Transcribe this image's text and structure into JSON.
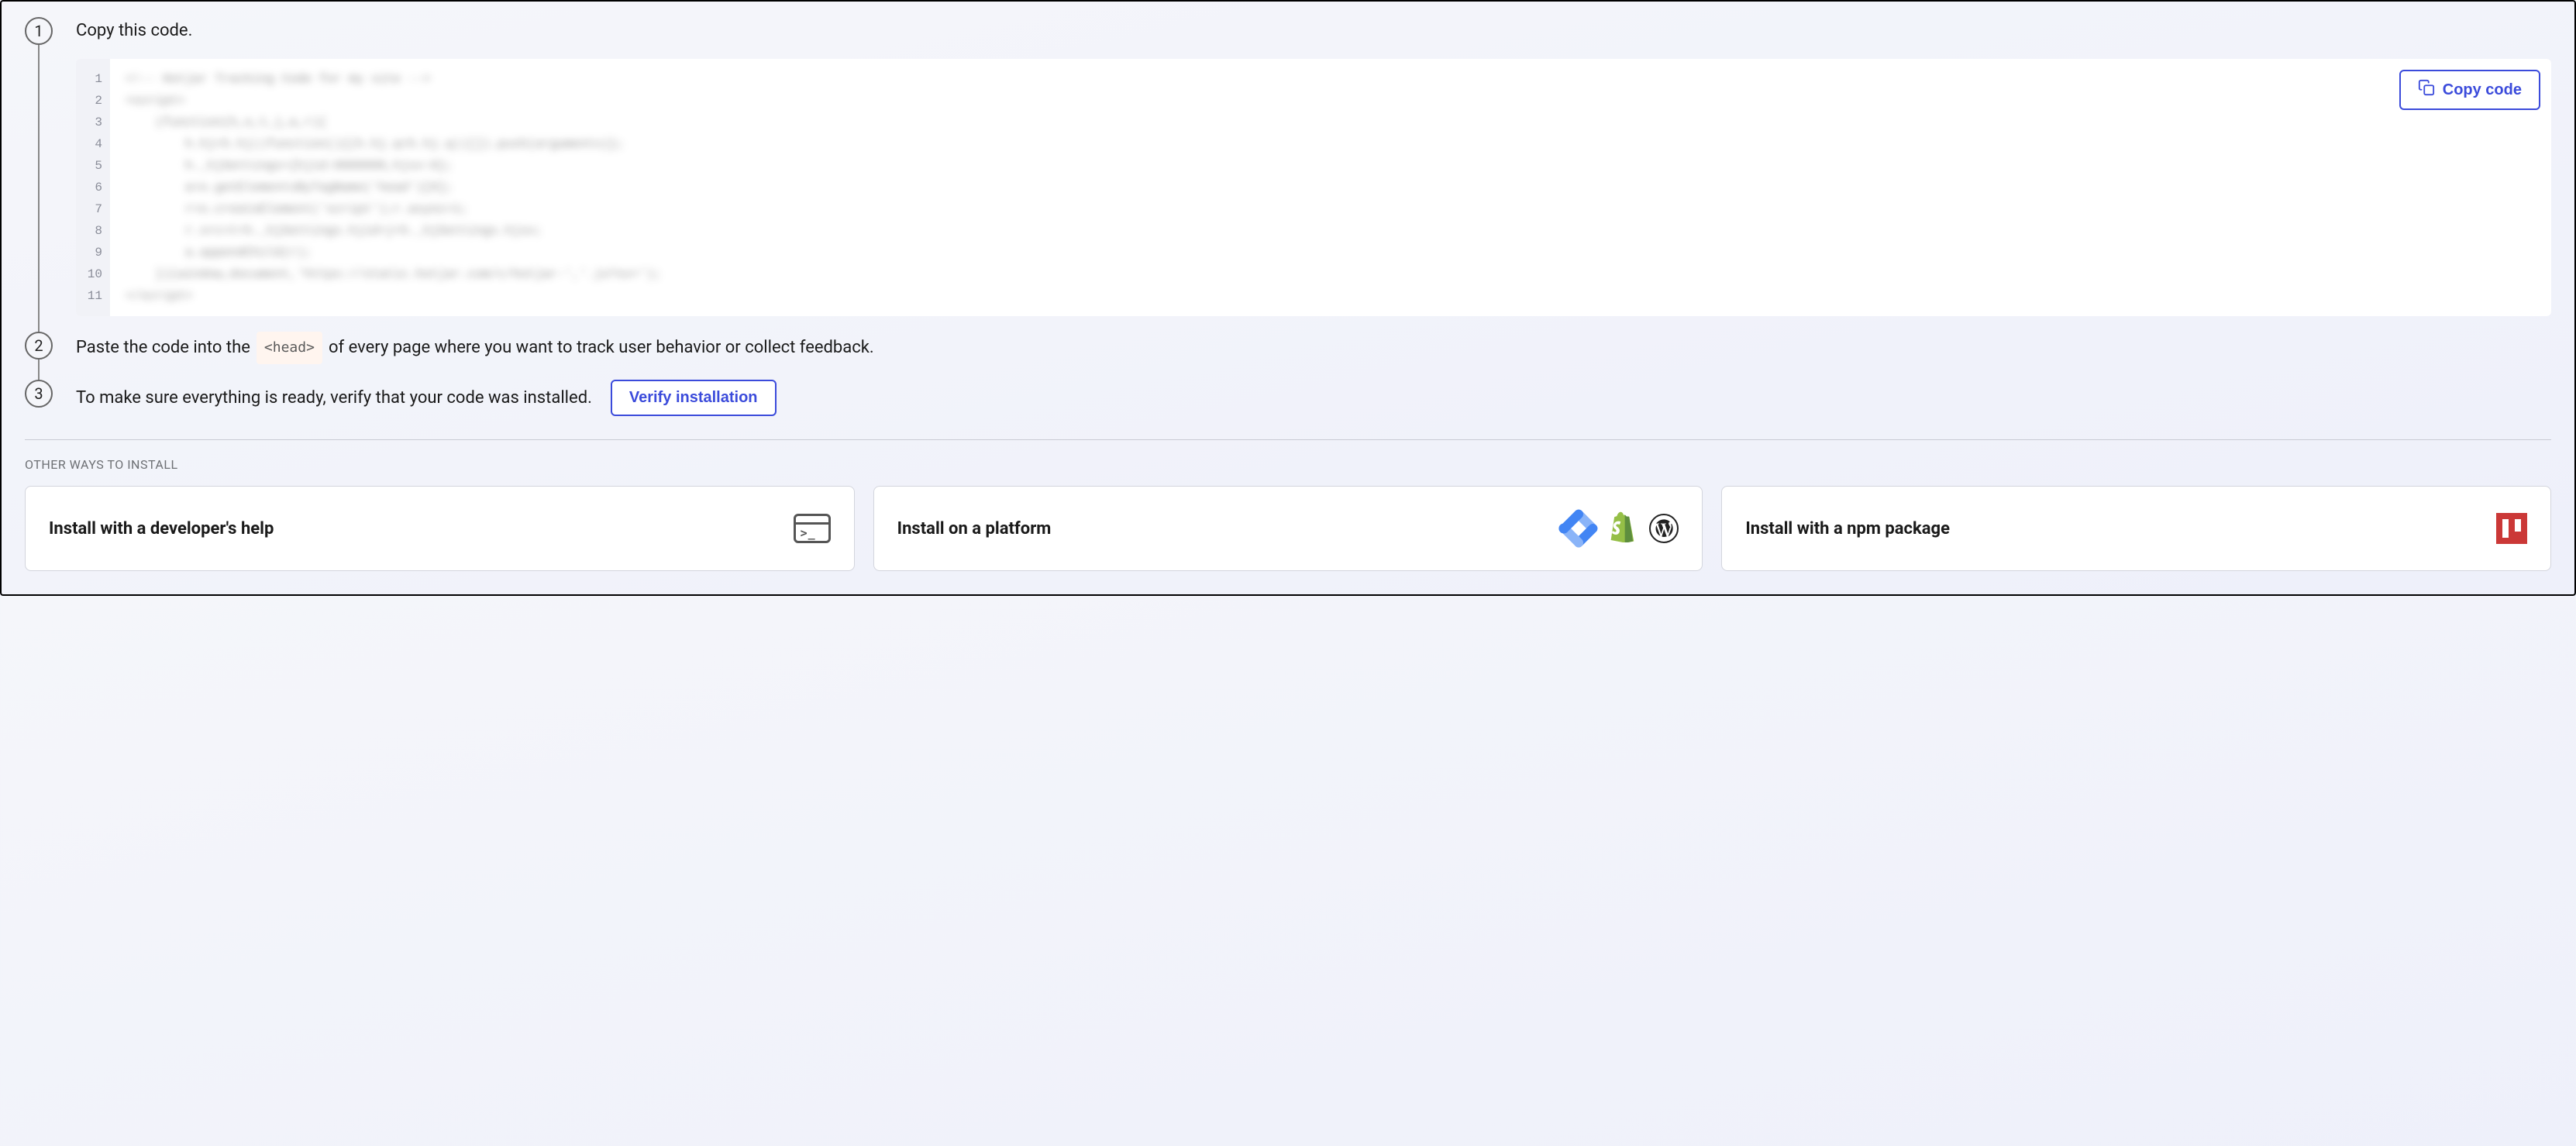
{
  "steps": {
    "s1": {
      "num": "1",
      "text": "Copy this code."
    },
    "s2": {
      "num": "2",
      "text_before": "Paste the code into the",
      "code_tag": "<head>",
      "text_after": "of every page where you want to track user behavior or collect feedback."
    },
    "s3": {
      "num": "3",
      "text": "To make sure everything is ready, verify that your code was installed.",
      "verify_label": "Verify installation"
    }
  },
  "copy_button": "Copy code",
  "code": {
    "line_count": 11,
    "lines": [
      "<!-- Hotjar Tracking Code for my site -->",
      "<script>",
      "    (function(h,o,t,j,a,r){",
      "        h.hj=h.hj||function(){(h.hj.q=h.hj.q||[]).push(arguments)};",
      "        h._hjSettings={hjid:0000000,hjsv:6};",
      "        a=o.getElementsByTagName('head')[0];",
      "        r=o.createElement('script');r.async=1;",
      "        r.src=t+h._hjSettings.hjid+j+h._hjSettings.hjsv;",
      "        a.appendChild(r);",
      "    })(window,document,'https://static.hotjar.com/c/hotjar-','.js?sv=');",
      "</script>"
    ]
  },
  "other_section_label": "OTHER WAYS TO INSTALL",
  "cards": {
    "dev": "Install with a developer's help",
    "platform": "Install on a platform",
    "npm": "Install with a npm package"
  }
}
